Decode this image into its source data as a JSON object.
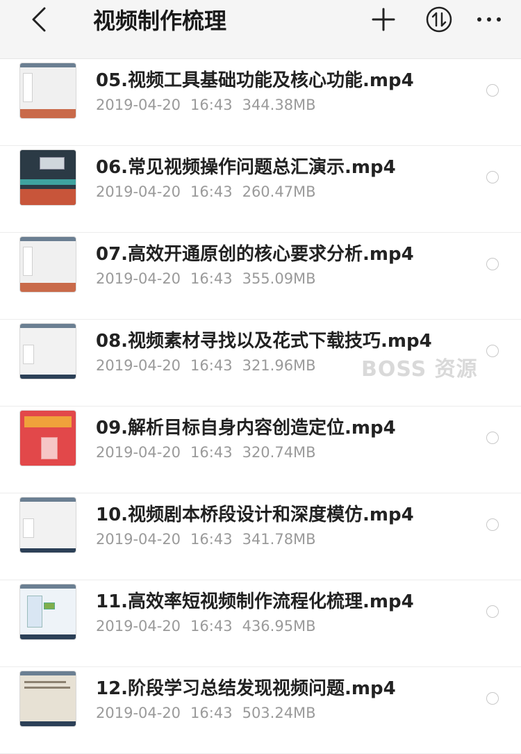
{
  "header": {
    "title": "视频制作梳理",
    "icons": [
      "back-arrow-icon",
      "plus-icon",
      "sort-icon",
      "more-icon"
    ]
  },
  "files": [
    {
      "name": "05.视频工具基础功能及核心功能.mp4",
      "date": "2019-04-20",
      "time": "16:43",
      "size": "344.38MB",
      "thumb_style": "editor-gray"
    },
    {
      "name": "06.常见视频操作问题总汇演示.mp4",
      "date": "2019-04-20",
      "time": "16:43",
      "size": "260.47MB",
      "thumb_style": "editor-dark"
    },
    {
      "name": "07.高效开通原创的核心要求分析.mp4",
      "date": "2019-04-20",
      "time": "16:43",
      "size": "355.09MB",
      "thumb_style": "editor-gray"
    },
    {
      "name": "08.视频素材寻找以及花式下载技巧.mp4",
      "date": "2019-04-20",
      "time": "16:43",
      "size": "321.96MB",
      "thumb_style": "mindmap-light"
    },
    {
      "name": "09.解析目标自身内容创造定位.mp4",
      "date": "2019-04-20",
      "time": "16:43",
      "size": "320.74MB",
      "thumb_style": "red-web"
    },
    {
      "name": "10.视频剧本桥段设计和深度模仿.mp4",
      "date": "2019-04-20",
      "time": "16:43",
      "size": "341.78MB",
      "thumb_style": "mindmap-light"
    },
    {
      "name": "11.高效率短视频制作流程化梳理.mp4",
      "date": "2019-04-20",
      "time": "16:43",
      "size": "436.95MB",
      "thumb_style": "mindmap-blue"
    },
    {
      "name": "12.阶段学习总结发现视频问题.mp4",
      "date": "2019-04-20",
      "time": "16:43",
      "size": "503.24MB",
      "thumb_style": "text-doc"
    }
  ],
  "watermark": "BOSS 资源",
  "colors": {
    "header_bg": "#f5f5f5",
    "meta_text": "#9a9a9a",
    "divider": "#ececec"
  }
}
